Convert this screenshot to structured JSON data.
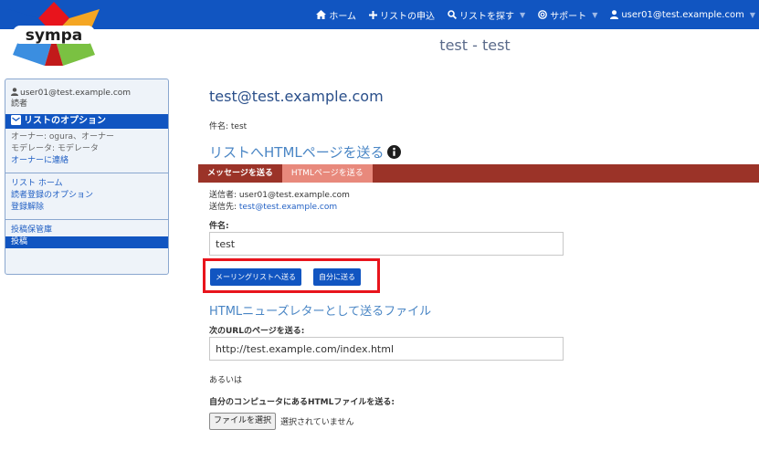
{
  "logo": {
    "text": "sympa",
    "colors": [
      "#e8141c",
      "#1155c1",
      "#f5a623",
      "#7ac142"
    ]
  },
  "topnav": {
    "items": [
      {
        "label": "ホーム",
        "icon": "home-icon",
        "dropdown": false
      },
      {
        "label": "リストの申込",
        "icon": "plus-icon",
        "dropdown": false
      },
      {
        "label": "リストを探す",
        "icon": "search-icon",
        "dropdown": true
      },
      {
        "label": "サポート",
        "icon": "support-icon",
        "dropdown": true
      },
      {
        "label": "user01@test.example.com",
        "icon": "user-icon",
        "dropdown": true
      }
    ],
    "background": "#1155c1"
  },
  "sidebar": {
    "user_email": "user01@test.example.com",
    "user_role": "読者",
    "header": "リストのオプション",
    "owner": "オーナー: ogura、オーナー",
    "moderator": "モデレータ: モデレータ",
    "contact_owner": "オーナーに連絡",
    "links": [
      "リスト ホーム",
      "読者登録のオプション",
      "登録解除"
    ],
    "moderation": "投稿保管庫",
    "post": "投稿"
  },
  "page": {
    "title": "test - test",
    "list_address": "test@test.example.com",
    "subject_line": "件名: test",
    "section_title": "リストへHTMLページを送る"
  },
  "tabs": [
    {
      "label": "メッセージを送る",
      "active": false
    },
    {
      "label": "HTMLページを送る",
      "active": true
    }
  ],
  "form": {
    "from_prefix": "送信者: ",
    "from_value": "user01@test.example.com",
    "to_prefix": "送信先: ",
    "to_value": "test@test.example.com",
    "subject_label": "件名:",
    "subject_value": "test",
    "send_to_list_button": "メーリングリストへ送る",
    "send_to_self_button": "自分に送る",
    "newsletter_title": "HTMLニューズレターとして送るファイル",
    "url_label": "次のURLのページを送る:",
    "url_value": "http://test.example.com/index.html",
    "or_text": "あるいは",
    "file_label": "自分のコンピュータにあるHTMLファイルを送る:",
    "file_button": "ファイルを選択",
    "file_status": "選択されていません"
  },
  "colors": {
    "tab_bar": "#9b3328",
    "tab_active": "#e8897c",
    "highlight": "#e8141c",
    "button": "#1155c1"
  }
}
